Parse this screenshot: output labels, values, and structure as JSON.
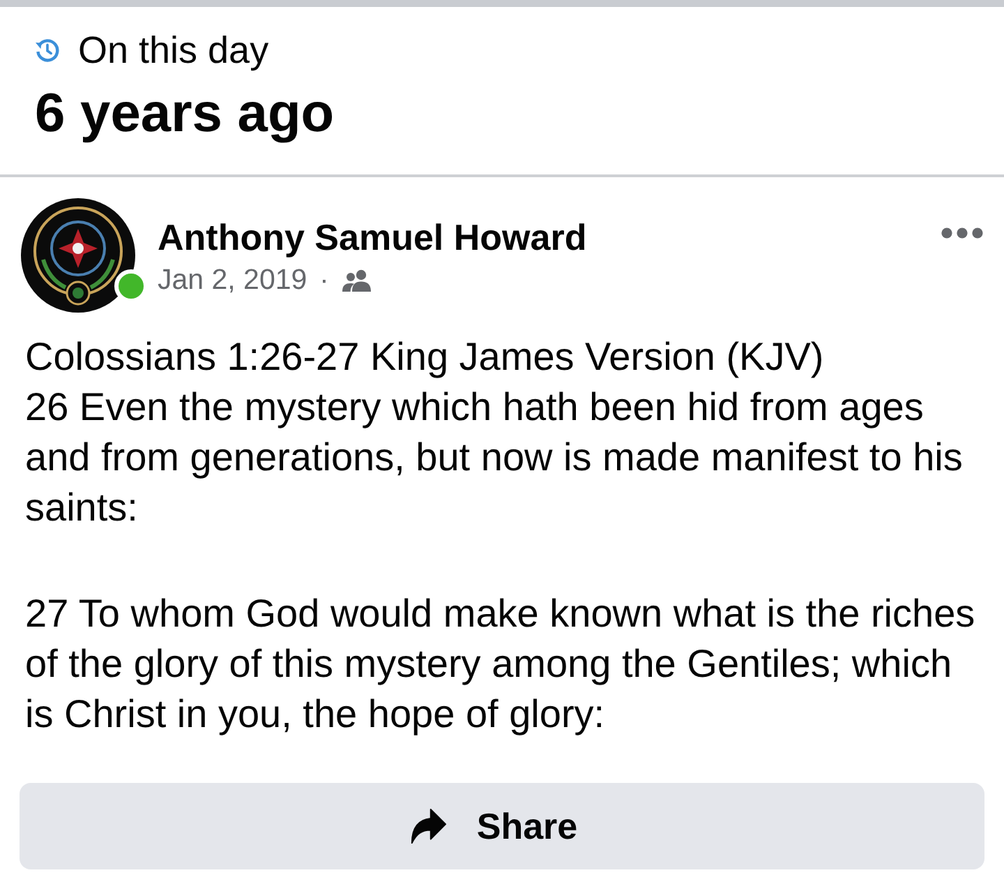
{
  "memory": {
    "label": "On this day",
    "heading": "6 years ago"
  },
  "post": {
    "author": {
      "name": "Anthony Samuel Howard",
      "online": true
    },
    "date": "Jan 2, 2019",
    "separator": "·",
    "paragraphs": [
      {
        "lines": [
          "Colossians 1:26-27 King James Version (KJV)",
          "26 Even the mystery which hath been hid from ages and from generations, but now is made manifest to his saints:"
        ]
      },
      {
        "lines": [
          "27 To whom God would make known what is the riches of the glory of this mystery among the Gentiles; which is Christ in you, the hope of glory:"
        ]
      }
    ],
    "share_button": {
      "label": "Share"
    }
  }
}
